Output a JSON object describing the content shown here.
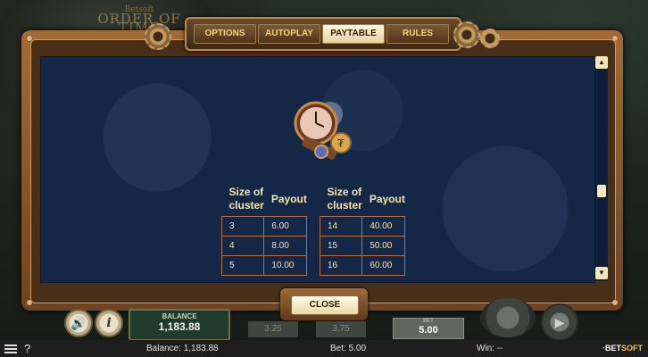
{
  "background": {
    "logo_small": "Betsoft",
    "logo_big": "ORDER OF TIME"
  },
  "tabs": [
    {
      "label": "OPTIONS",
      "active": false
    },
    {
      "label": "AUTOPLAY",
      "active": false
    },
    {
      "label": "PAYTABLE",
      "active": true
    },
    {
      "label": "RULES",
      "active": false
    }
  ],
  "paytable": {
    "symbol_icon": "pocket-watch-icon",
    "headers": {
      "size": "Size of cluster",
      "payout": "Payout"
    },
    "left_table": [
      {
        "size": "3",
        "payout": "6.00"
      },
      {
        "size": "4",
        "payout": "8.00"
      },
      {
        "size": "5",
        "payout": "10.00"
      }
    ],
    "right_table": [
      {
        "size": "14",
        "payout": "40.00"
      },
      {
        "size": "15",
        "payout": "50.00"
      },
      {
        "size": "16",
        "payout": "60.00"
      }
    ],
    "scroll_up": "▲",
    "scroll_down": "▼"
  },
  "close_label": "CLOSE",
  "controls": {
    "balance_label": "BALANCE",
    "balance_value": "1,183.88",
    "dim_left": "3.25",
    "dim_right": "3.75",
    "bet_label": "BET",
    "bet_value": "5.00",
    "info_label": "i",
    "sound_label": "🔊",
    "play_label": "▶"
  },
  "status": {
    "help": "?",
    "balance_text": "Balance: 1,183.88",
    "bet_text": "Bet: 5.00",
    "win_text": "Win: --",
    "brand_prefix": "·BET",
    "brand_suffix": "SOFT"
  },
  "colors": {
    "panel_bg": "#142747",
    "copper": "#a36b36",
    "text_gold": "#f4e4b0",
    "active_tab": "#fff7da"
  }
}
